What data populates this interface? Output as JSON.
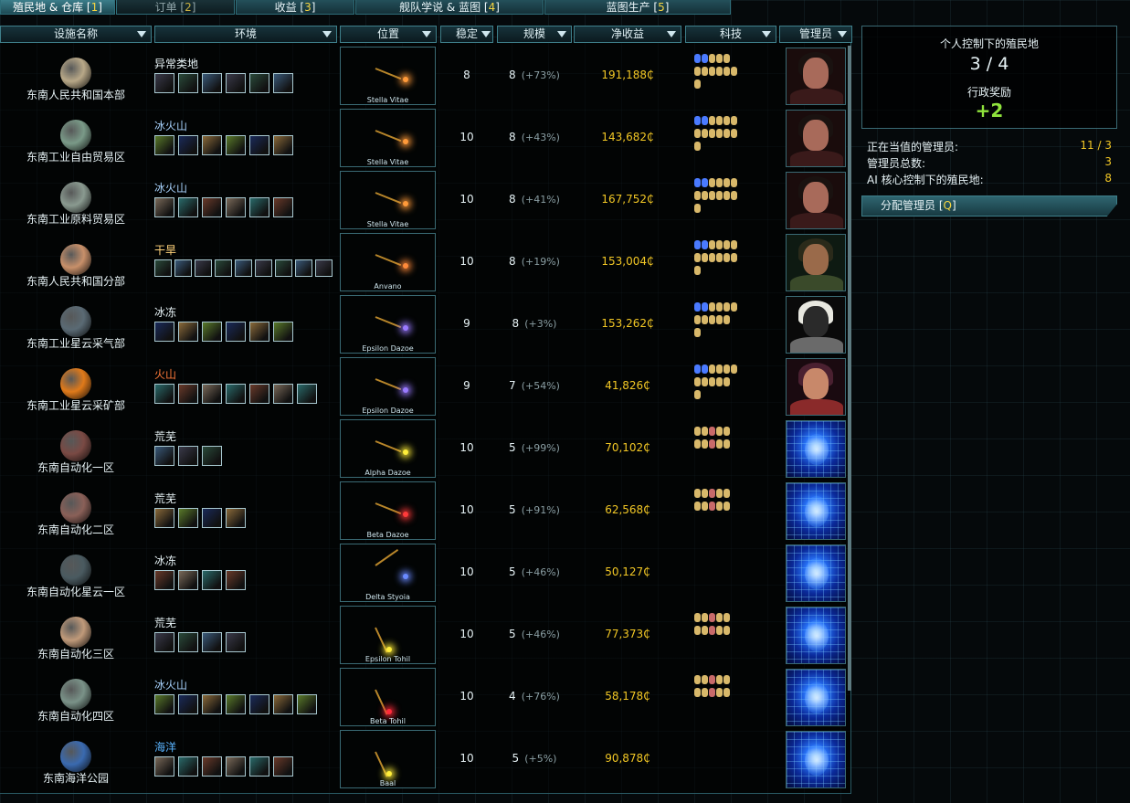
{
  "tabs": [
    {
      "label": "殖民地 & 仓库",
      "key": "1"
    },
    {
      "label": "订单",
      "key": "2"
    },
    {
      "label": "收益",
      "key": "3"
    },
    {
      "label": "舰队学说 & 蓝图",
      "key": "4"
    },
    {
      "label": "蓝图生产",
      "key": "5"
    }
  ],
  "columns": {
    "name": "设施名称",
    "env": "环境",
    "loc": "位置",
    "stab": "稳定",
    "size": "规模",
    "income": "净收益",
    "tech": "科技",
    "admin": "管理员"
  },
  "colonies": [
    {
      "name": "东南人民共和国本部",
      "env": "异常类地",
      "env_color": "#e6f2f5",
      "system": "Stella Vitae",
      "stability": "8",
      "size": "8",
      "growth": "(+73%)",
      "income": "191,188₵",
      "planet": "#b8a888",
      "star": "#ff9a3a",
      "icons": 6,
      "tech": [
        5,
        6,
        1
      ],
      "admin": "human-1"
    },
    {
      "name": "东南工业自由贸易区",
      "env": "冰火山",
      "env_color": "#a9d4ff",
      "system": "Stella Vitae",
      "stability": "10",
      "size": "8",
      "growth": "(+43%)",
      "income": "143,682₵",
      "planet": "#7a9a88",
      "star": "#ff9a3a",
      "icons": 6,
      "tech": [
        6,
        6,
        1
      ],
      "admin": "human-1"
    },
    {
      "name": "东南工业原料贸易区",
      "env": "冰火山",
      "env_color": "#a9d4ff",
      "system": "Stella Vitae",
      "stability": "10",
      "size": "8",
      "growth": "(+41%)",
      "income": "167,752₵",
      "planet": "#8a9a90",
      "star": "#ff9a3a",
      "icons": 6,
      "tech": [
        6,
        6,
        1
      ],
      "admin": "human-1"
    },
    {
      "name": "东南人民共和国分部",
      "env": "干旱",
      "env_color": "#ffd27a",
      "system": "Anvano",
      "stability": "10",
      "size": "8",
      "growth": "(+19%)",
      "income": "153,004₵",
      "planet": "#c8906a",
      "star": "#ff8a3a",
      "icons": 9,
      "tech": [
        6,
        6,
        1
      ],
      "admin": "human-2"
    },
    {
      "name": "东南工业星云采气部",
      "env": "冰冻",
      "env_color": "#e6f2f5",
      "system": "Epsilon Dazoe",
      "stability": "9",
      "size": "8",
      "growth": "(+3%)",
      "income": "153,262₵",
      "planet": "#5a6a74",
      "star": "#9a7aff",
      "icons": 6,
      "tech": [
        6,
        5,
        1
      ],
      "admin": "human-3"
    },
    {
      "name": "东南工业星云采矿部",
      "env": "火山",
      "env_color": "#ff7a3a",
      "system": "Epsilon Dazoe",
      "stability": "9",
      "size": "7",
      "growth": "(+54%)",
      "income": "41,826₵",
      "planet": "#e07a1a",
      "star": "#9a7aff",
      "icons": 7,
      "tech": [
        6,
        5,
        1
      ],
      "admin": "human-4"
    },
    {
      "name": "东南自动化一区",
      "env": "荒芜",
      "env_color": "#e6f2f5",
      "system": "Alpha Dazoe",
      "stability": "10",
      "size": "5",
      "growth": "(+99%)",
      "income": "70,102₵",
      "planet": "#7a4a44",
      "star": "#ffee3a",
      "icons": 3,
      "tech": [
        5,
        5,
        0
      ],
      "admin": "ai"
    },
    {
      "name": "东南自动化二区",
      "env": "荒芜",
      "env_color": "#e6f2f5",
      "system": "Beta Dazoe",
      "stability": "10",
      "size": "5",
      "growth": "(+91%)",
      "income": "62,568₵",
      "planet": "#8a6058",
      "star": "#ff3a3a",
      "icons": 4,
      "tech": [
        5,
        5,
        0
      ],
      "admin": "ai"
    },
    {
      "name": "东南自动化星云一区",
      "env": "冰冻",
      "env_color": "#e6f2f5",
      "system": "Delta Styoia",
      "stability": "10",
      "size": "5",
      "growth": "(+46%)",
      "income": "50,127₵",
      "planet": "#4a5a60",
      "star": "#6a8aff",
      "icons": 4,
      "tech": [
        0,
        0,
        0
      ],
      "admin": "ai"
    },
    {
      "name": "东南自动化三区",
      "env": "荒芜",
      "env_color": "#e6f2f5",
      "system": "Epsilon Tohil",
      "stability": "10",
      "size": "5",
      "growth": "(+46%)",
      "income": "77,373₵",
      "planet": "#c09a7a",
      "star": "#ffee3a",
      "icons": 4,
      "tech": [
        5,
        5,
        0
      ],
      "admin": "ai"
    },
    {
      "name": "东南自动化四区",
      "env": "冰火山",
      "env_color": "#a9d4ff",
      "system": "Beta Tohil",
      "stability": "10",
      "size": "4",
      "growth": "(+76%)",
      "income": "58,178₵",
      "planet": "#7a9288",
      "star": "#ff2a3a",
      "icons": 7,
      "tech": [
        5,
        5,
        0
      ],
      "admin": "ai"
    },
    {
      "name": "东南海洋公园",
      "env": "海洋",
      "env_color": "#5ab4ff",
      "system": "Baal",
      "stability": "10",
      "size": "5",
      "growth": "(+5%)",
      "income": "90,878₵",
      "planet": "#3a6ab0",
      "star": "#ffee3a",
      "icons": 6,
      "tech": [
        0,
        0,
        0
      ],
      "admin": "ai"
    }
  ],
  "panel": {
    "personal_title": "个人控制下的殖民地",
    "personal_count": "3 / 4",
    "bonus_label": "行政奖励",
    "bonus_value": "+2"
  },
  "stats": [
    {
      "label": "正在当值的管理员:",
      "value": "11 / 3"
    },
    {
      "label": "管理员总数:",
      "value": "3"
    },
    {
      "label": "AI 核心控制下的殖民地:",
      "value": "8"
    }
  ],
  "assign": {
    "label": "分配管理员 [",
    "key": "Q",
    "close": "]"
  },
  "colors": {
    "accent": "#3e7f8a",
    "income": "#f3c825",
    "bonus": "#8fe23c",
    "hotkey": "#f5d542"
  }
}
